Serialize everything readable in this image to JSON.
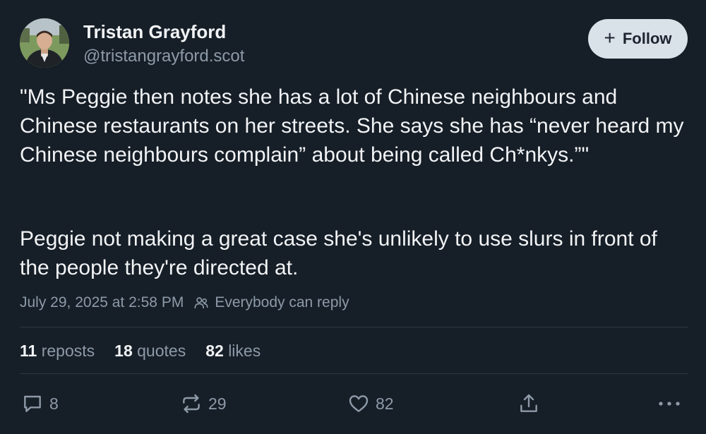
{
  "author": {
    "display_name": "Tristan Grayford",
    "handle": "@tristangrayford.scot",
    "avatar_icon": "profile-photo"
  },
  "follow_button": {
    "label": "Follow",
    "icon": "plus-icon"
  },
  "post": {
    "paragraphs": [
      "\"Ms Peggie then notes she has a lot of Chinese neighbours and Chinese restaurants on her streets. She says she has “never heard my Chinese neighbours complain” about being called Ch*nkys.”\"",
      "Peggie not making a great case she's unlikely to use slurs in front of the people they're directed at."
    ],
    "timestamp": "July 29, 2025 at 2:58 PM",
    "reply_setting": "Everybody can reply"
  },
  "stats": {
    "reposts": {
      "count": "11",
      "label": "reposts"
    },
    "quotes": {
      "count": "18",
      "label": "quotes"
    },
    "likes": {
      "count": "82",
      "label": "likes"
    }
  },
  "actions": {
    "reply_count": "8",
    "repost_count": "29",
    "like_count": "82"
  },
  "colors": {
    "background": "#161e27",
    "text": "#f1f3f5",
    "muted": "#8d9aa8",
    "follow_bg": "#d9e1e9",
    "divider": "#2c3744"
  }
}
